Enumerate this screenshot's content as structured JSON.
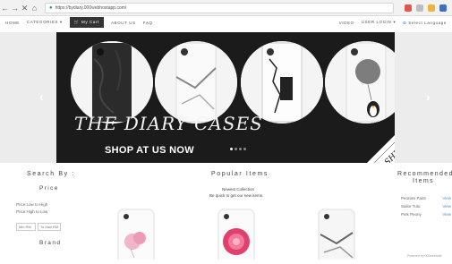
{
  "browser": {
    "url": "https://bydiary.000webhostapp.com/"
  },
  "nav": {
    "home": "HOME",
    "categories": "CATEGORIES ▾",
    "my_cart": "My Cart",
    "about_us": "ABOUT US",
    "faq": "FAQ",
    "video": "VIDEO",
    "user_login": "USER LOGIN ▾",
    "select_language": "Select Language"
  },
  "hero": {
    "title": "THE DIARY CASES",
    "cta": "SHOP AT US NOW",
    "ribbon": "FREE SHIPPING",
    "slide_count": 4,
    "active_slide": 1
  },
  "sidebar": {
    "search_by": "Search By :",
    "price_title": "Price",
    "filters": [
      "Price:Low to High",
      "Price:High to Low"
    ],
    "min_placeholder": "Min RM",
    "max_placeholder": "To Max RM",
    "brand_title": "Brand"
  },
  "popular": {
    "title": "Popular Items",
    "newest": "Newest Collection",
    "tagline": "Be quick to get our new items."
  },
  "recommended": {
    "title": "Recommended Items",
    "items": [
      {
        "name": "Peonies Paint",
        "action": "View"
      },
      {
        "name": "Sailor Tutu",
        "action": "View"
      },
      {
        "name": "Pink Peony",
        "action": "View"
      }
    ],
    "powered_by": "Powered by 000webhost"
  }
}
